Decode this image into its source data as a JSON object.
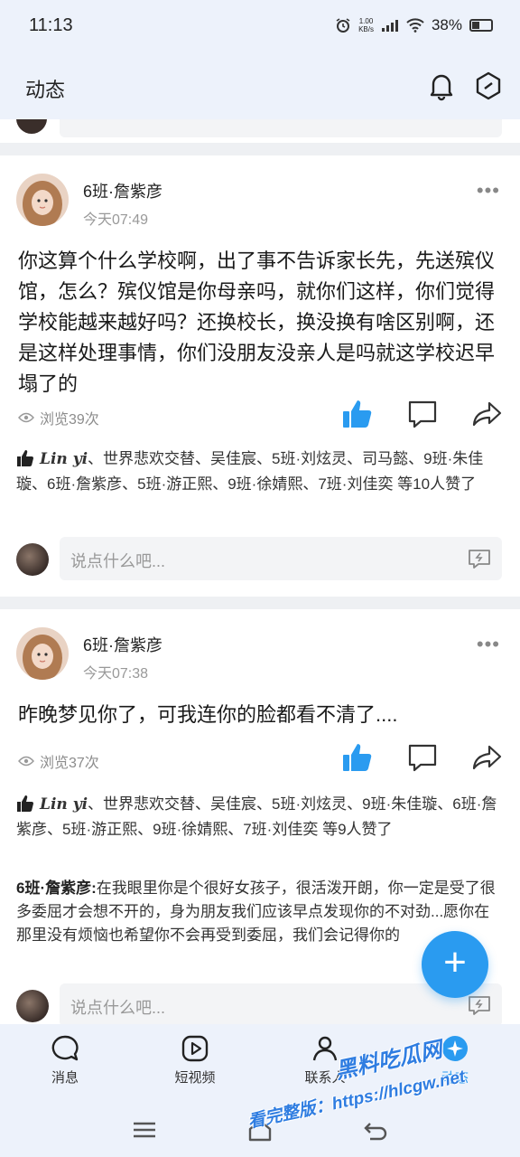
{
  "status_bar": {
    "time": "11:13",
    "net_speed_value": "1.00",
    "net_speed_unit": "KB/s",
    "battery": "38%",
    "battery_level": 0.38
  },
  "header": {
    "title": "动态"
  },
  "posts": [
    {
      "author": "6班·詹紫彦",
      "time": "今天07:49",
      "text": "你这算个什么学校啊，出了事不告诉家长先，先送殡仪馆，怎么？殡仪馆是你母亲吗，就你们这样，你们觉得学校能越来越好吗？还换校长，换没换有啥区别啊，还是这样处理事情，你们没朋友没亲人是吗就这学校迟早塌了的",
      "views": "浏览39次",
      "likes_sig": "Lin yi",
      "likes_text": "、世界悲欢交替、吴佳宸、5班·刘炫灵、司马懿、9班·朱佳璇、6班·詹紫彦、5班·游正熙、9班·徐婧熙、7班·刘佳奕 等10人赞了",
      "comment_placeholder": "说点什么吧..."
    },
    {
      "author": "6班·詹紫彦",
      "time": "今天07:38",
      "text": "昨晚梦见你了，可我连你的脸都看不清了....",
      "views": "浏览37次",
      "likes_sig": "Lin yi",
      "likes_text": "、世界悲欢交替、吴佳宸、5班·刘炫灵、9班·朱佳璇、6班·詹紫彦、5班·游正熙、9班·徐婧熙、7班·刘佳奕 等9人赞了",
      "comment_author": "6班·詹紫彦:",
      "comment_text": "在我眼里你是个很好女孩子，很活泼开朗，你一定是受了很多委屈才会想不开的，身为朋友我们应该早点发现你的不对劲...愿你在那里没有烦恼也希望你不会再受到委屈，我们会记得你的",
      "comment_placeholder": "说点什么吧..."
    }
  ],
  "bottom_nav": [
    {
      "label": "消息",
      "icon": "chat-bubble-icon"
    },
    {
      "label": "短视频",
      "icon": "play-video-icon"
    },
    {
      "label": "联系人",
      "icon": "contacts-icon"
    },
    {
      "label": "动态",
      "icon": "moments-icon",
      "active": true
    }
  ],
  "watermark": {
    "line1": "黑料吃瓜网",
    "line2": "看完整版：https://hlcgw.net"
  },
  "colors": {
    "accent": "#2a9bf0",
    "bar_bg": "#edf2fb",
    "divider": "#eef0f3"
  }
}
